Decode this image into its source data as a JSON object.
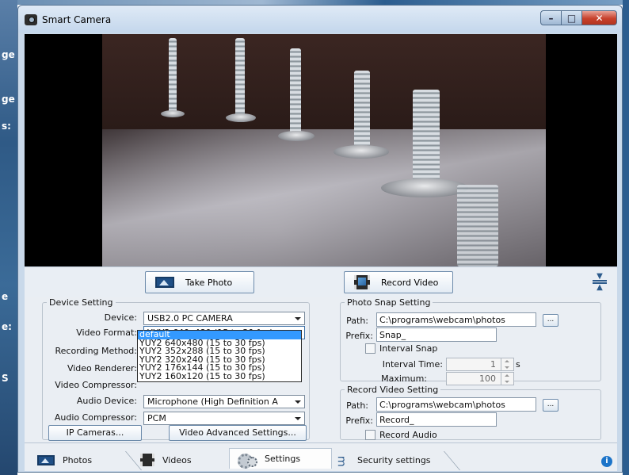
{
  "window": {
    "title": "Smart Camera"
  },
  "background": {
    "fragments": [
      "ge",
      "ge",
      "s:",
      "e",
      "e:",
      "S"
    ]
  },
  "actions": {
    "take_photo": "Take Photo",
    "record_video": "Record Video"
  },
  "device_setting": {
    "legend": "Device Setting",
    "device_label": "Device:",
    "device_value": "USB2.0 PC CAMERA",
    "video_format_label": "Video Format:",
    "video_format_value": "YUY2 640x480 (15 to 30 fps)",
    "recording_method_label": "Recording Method:",
    "video_renderer_label": "Video Renderer:",
    "video_compressor_label": "Video Compressor:",
    "audio_device_label": "Audio Device:",
    "audio_device_value": "Microphone (High Definition A",
    "audio_compressor_label": "Audio Compressor:",
    "audio_compressor_value": "PCM",
    "ip_cameras": "IP Cameras...",
    "video_advanced": "Video Advanced Settings...",
    "format_options": [
      "default",
      "YUY2 640x480 (15 to 30 fps)",
      "YUY2 352x288 (15 to 30 fps)",
      "YUY2 320x240 (15 to 30 fps)",
      "YUY2 176x144 (15 to 30 fps)",
      "YUY2 160x120 (15 to 30 fps)"
    ]
  },
  "photo_snap": {
    "legend": "Photo Snap Setting",
    "path_label": "Path:",
    "path_value": "C:\\programs\\webcam\\photos",
    "browse": "...",
    "prefix_label": "Prefix:",
    "prefix_value": "Snap_",
    "interval_snap": "Interval Snap",
    "interval_time_label": "Interval Time:",
    "interval_time_value": "1",
    "interval_unit": "s",
    "maximum_label": "Maximum:",
    "maximum_value": "100"
  },
  "record_video": {
    "legend": "Record Video Setting",
    "path_label": "Path:",
    "path_value": "C:\\programs\\webcam\\photos",
    "browse": "...",
    "prefix_label": "Prefix:",
    "prefix_value": "Record_",
    "record_audio": "Record Audio"
  },
  "tabs": [
    {
      "label": "Photos"
    },
    {
      "label": "Videos"
    },
    {
      "label": "Settings"
    },
    {
      "label": "Security settings"
    }
  ],
  "info": "i"
}
